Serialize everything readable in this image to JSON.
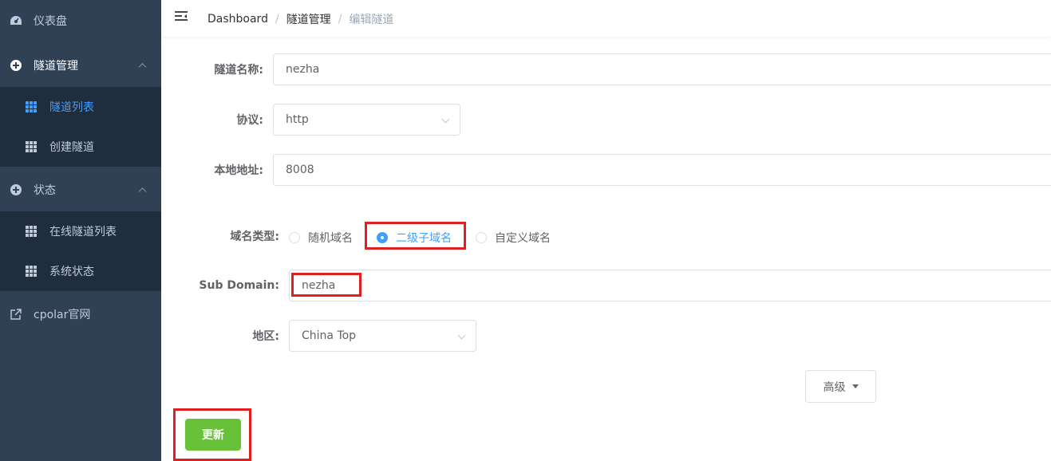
{
  "sidebar": {
    "dashboard": "仪表盘",
    "tunnel_mgmt": "隧道管理",
    "tunnel_list": "隧道列表",
    "create_tunnel": "创建隧道",
    "status": "状态",
    "online_tunnels": "在线隧道列表",
    "system_status": "系统状态",
    "cpolar_site": "cpolar官网"
  },
  "breadcrumb": {
    "home": "Dashboard",
    "section": "隧道管理",
    "current": "编辑隧道",
    "separator": "/"
  },
  "form": {
    "name_label": "隧道名称:",
    "name_value": "nezha",
    "protocol_label": "协议:",
    "protocol_value": "http",
    "local_label": "本地地址:",
    "local_value": "8008",
    "domain_type_label": "域名类型:",
    "domain_options": [
      "随机域名",
      "二级子域名",
      "自定义域名"
    ],
    "domain_selected": "二级子域名",
    "subdomain_label": "Sub Domain:",
    "subdomain_value": "nezha",
    "region_label": "地区:",
    "region_value": "China Top"
  },
  "buttons": {
    "advanced": "高级",
    "update": "更新"
  },
  "colors": {
    "sidebar_bg": "#304156",
    "submenu_bg": "#1f2d3d",
    "active": "#409eff",
    "update_button": "#67c23a",
    "highlight_box": "#e02020"
  }
}
